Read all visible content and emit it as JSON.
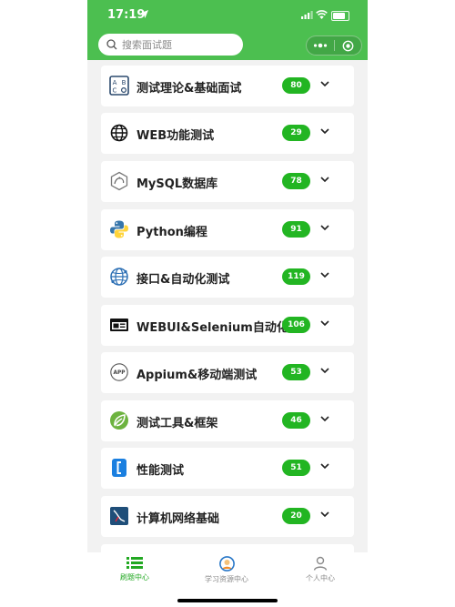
{
  "status_bar": {
    "time": "17:19"
  },
  "search": {
    "placeholder": "搜索面试题"
  },
  "colors": {
    "brand": "#4cbf50",
    "badge": "#22b522",
    "tab_active": "#22a822",
    "tab_inactive": "#8a8a8a"
  },
  "categories": [
    {
      "title": "测试理论&基础面试",
      "count": "80",
      "icon": "abc-grid-icon"
    },
    {
      "title": "WEB功能测试",
      "count": "29",
      "icon": "globe-icon"
    },
    {
      "title": "MySQL数据库",
      "count": "78",
      "icon": "mysql-icon"
    },
    {
      "title": "Python编程",
      "count": "91",
      "icon": "python-icon"
    },
    {
      "title": "接口&自动化测试",
      "count": "119",
      "icon": "network-globe-icon"
    },
    {
      "title": "WEBUI&Selenium自动化",
      "count": "106",
      "icon": "browser-window-icon"
    },
    {
      "title": "Appium&移动端测试",
      "count": "53",
      "icon": "app-icon"
    },
    {
      "title": "测试工具&框架",
      "count": "46",
      "icon": "leaf-icon"
    },
    {
      "title": "性能测试",
      "count": "51",
      "icon": "bracket-icon"
    },
    {
      "title": "计算机网络基础",
      "count": "20",
      "icon": "terminal-icon"
    }
  ],
  "tabbar": [
    {
      "label": "刷题中心",
      "icon": "list-icon",
      "active": true
    },
    {
      "label": "学习资源中心",
      "icon": "avatar-icon",
      "active": false
    },
    {
      "label": "个人中心",
      "icon": "person-icon",
      "active": false
    }
  ]
}
